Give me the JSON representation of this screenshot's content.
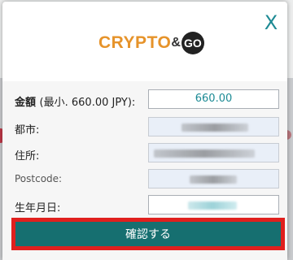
{
  "modal": {
    "close_symbol": "X",
    "logo": {
      "crypto": "CRYPTO",
      "amp": "&",
      "go": "GO"
    }
  },
  "form": {
    "amount": {
      "label": "金額",
      "min_note": "(最小. 660.00 JPY):",
      "value": "660.00"
    },
    "city": {
      "label": "都市:"
    },
    "address": {
      "label": "住所:"
    },
    "postcode": {
      "label": "Postcode:"
    },
    "birthdate": {
      "label": "生年月日:"
    }
  },
  "confirm_button": {
    "label": "確認する"
  },
  "colors": {
    "accent_teal": "#1b8a94",
    "button_bg": "#166f70",
    "highlight_red": "#e0201e",
    "logo_orange": "#e6932a"
  }
}
